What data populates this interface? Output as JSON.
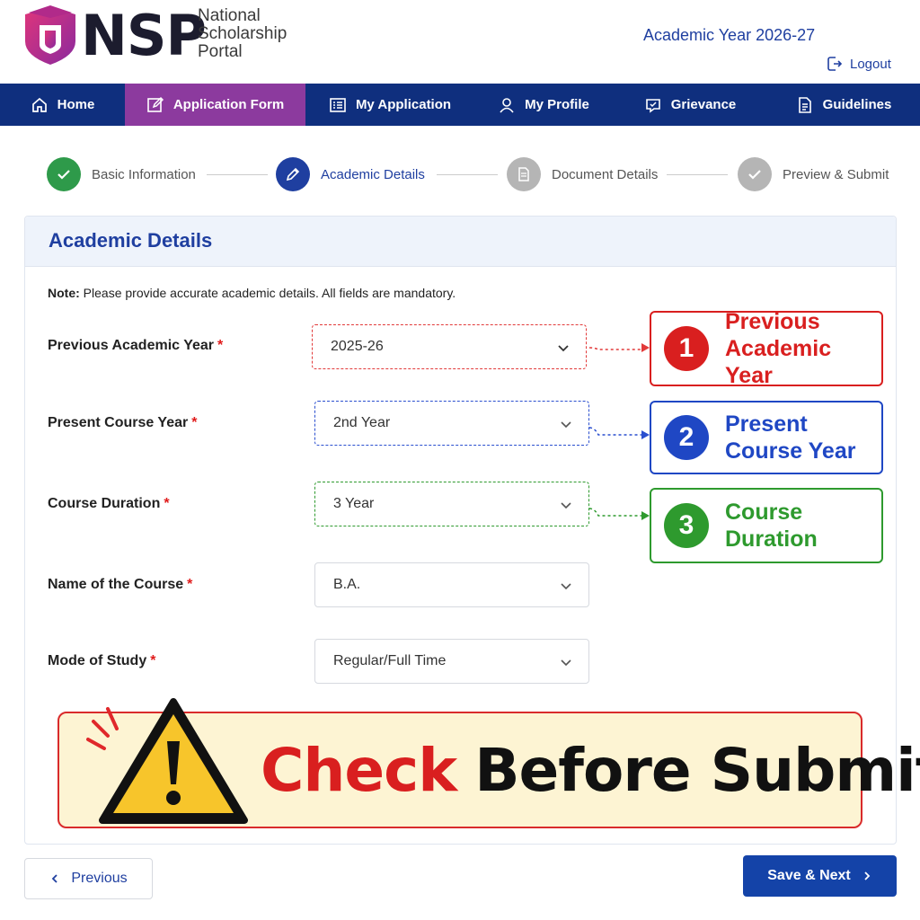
{
  "header": {
    "logo_text": "NSP",
    "logo_subtitle_line1": "National",
    "logo_subtitle_line2": "Scholarship",
    "logo_subtitle_line3": "Portal",
    "academic_year": "Academic Year 2026-27",
    "logout_label": "Logout"
  },
  "nav": {
    "items": [
      {
        "label": "Home",
        "icon": "home-icon"
      },
      {
        "label": "Application Form",
        "icon": "edit-icon",
        "active": true
      },
      {
        "label": "My Application",
        "icon": "list-icon"
      },
      {
        "label": "My Profile",
        "icon": "user-icon"
      },
      {
        "label": "Grievance",
        "icon": "chat-icon"
      },
      {
        "label": "Guidelines",
        "icon": "document-icon"
      }
    ]
  },
  "stepper": {
    "steps": [
      {
        "label": "Basic Information",
        "status": "completed",
        "color": "#2e9a4a"
      },
      {
        "label": "Academic Details",
        "status": "current",
        "color": "#1f3fa0"
      },
      {
        "label": "Document Details",
        "status": "pending",
        "color": "#b5b5b5"
      },
      {
        "label": "Preview & Submit",
        "status": "pending",
        "color": "#b5b5b5"
      }
    ]
  },
  "form": {
    "title": "Academic Details",
    "note_label": "Note:",
    "note_text": " Please provide accurate academic details. All fields are mandatory.",
    "required_mark": "*",
    "fields": [
      {
        "label": "Previous Academic Year",
        "value": "2025-26"
      },
      {
        "label": "Present Course Year",
        "value": "2nd Year"
      },
      {
        "label": "Course Duration",
        "value": "3 Year"
      },
      {
        "label": "Name of the Course",
        "value": "B.A."
      },
      {
        "label": "Mode of Study",
        "value": "Regular/Full Time"
      }
    ]
  },
  "callouts": [
    {
      "number": "1",
      "line1": "Previous",
      "line2": "Academic Year",
      "color": "#d91f1f"
    },
    {
      "number": "2",
      "line1": "Present",
      "line2": "Course Year",
      "color": "#1f47c4"
    },
    {
      "number": "3",
      "line1": "Course",
      "line2": "Duration",
      "color": "#2e9a2e"
    }
  ],
  "banner": {
    "text_red": "Check",
    "text_black": "Before Submit"
  },
  "footer": {
    "previous_label": "Previous",
    "next_label": "Save & Next"
  },
  "colors": {
    "nav_bg": "#0f2f7e",
    "nav_active": "#8c3a9e",
    "primary": "#1f3fa0",
    "banner_bg": "#fdf4d3",
    "banner_border": "#d92b2b"
  }
}
